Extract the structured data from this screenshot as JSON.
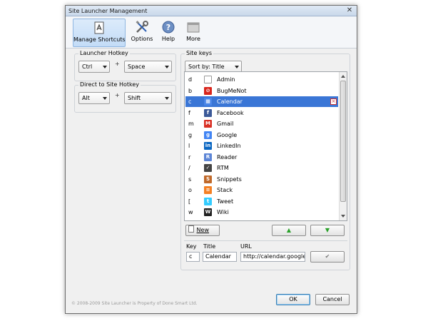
{
  "window": {
    "title": "Site Launcher Management",
    "close_glyph": "✕"
  },
  "toolbar": {
    "items": [
      {
        "label": "Manage Shortcuts",
        "icon": "manage-shortcuts-icon"
      },
      {
        "label": "Options",
        "icon": "wrench-screwdriver-icon"
      },
      {
        "label": "Help",
        "icon": "help-icon"
      },
      {
        "label": "More",
        "icon": "more-icon"
      }
    ]
  },
  "launcher_hotkey": {
    "title": "Launcher Hotkey",
    "modifier": "Ctrl",
    "plus": "+",
    "key": "Space"
  },
  "direct_hotkey": {
    "title": "Direct to Site Hotkey",
    "modifier": "Alt",
    "plus": "+",
    "key": "Shift"
  },
  "site_keys": {
    "title": "Site keys",
    "sort_label": "Sort by: Title",
    "rows": [
      {
        "key": "d",
        "title": "Admin",
        "icon": "page-icon",
        "color": "#ffffff"
      },
      {
        "key": "b",
        "title": "BugMeNot",
        "icon": "no-sign-icon",
        "color": "#d9261c"
      },
      {
        "key": "c",
        "title": "Calendar",
        "icon": "calendar-icon",
        "color": "#4a86e8",
        "selected": true
      },
      {
        "key": "f",
        "title": "Facebook",
        "icon": "facebook-icon",
        "color": "#3b5998"
      },
      {
        "key": "m",
        "title": "Gmail",
        "icon": "gmail-icon",
        "color": "#d93025"
      },
      {
        "key": "g",
        "title": "Google",
        "icon": "google-icon",
        "color": "#4285f4"
      },
      {
        "key": "l",
        "title": "LinkedIn",
        "icon": "linkedin-icon",
        "color": "#0a66c2"
      },
      {
        "key": "r",
        "title": "Reader",
        "icon": "reader-icon",
        "color": "#5c85d6"
      },
      {
        "key": "/",
        "title": "RTM",
        "icon": "rtm-icon",
        "color": "#444444"
      },
      {
        "key": "s",
        "title": "Snippets",
        "icon": "snippets-icon",
        "color": "#c0692a"
      },
      {
        "key": "o",
        "title": "Stack",
        "icon": "stack-icon",
        "color": "#f48024"
      },
      {
        "key": "[",
        "title": "Tweet",
        "icon": "twitter-icon",
        "color": "#33ccff"
      },
      {
        "key": "w",
        "title": "Wiki",
        "icon": "wikipedia-icon",
        "color": "#222222"
      }
    ],
    "new_label": "New",
    "move_up_glyph": "▲",
    "move_down_glyph": "▼"
  },
  "editor": {
    "key_label": "Key",
    "title_label": "Title",
    "url_label": "URL",
    "key_value": "c",
    "title_value": "Calendar",
    "url_value": "http://calendar.google.co",
    "apply_glyph": "✔"
  },
  "footer": {
    "copyright": "© 2008-2009 Site Launcher is Property of Done Smart Ltd.",
    "ok_label": "OK",
    "cancel_label": "Cancel"
  }
}
